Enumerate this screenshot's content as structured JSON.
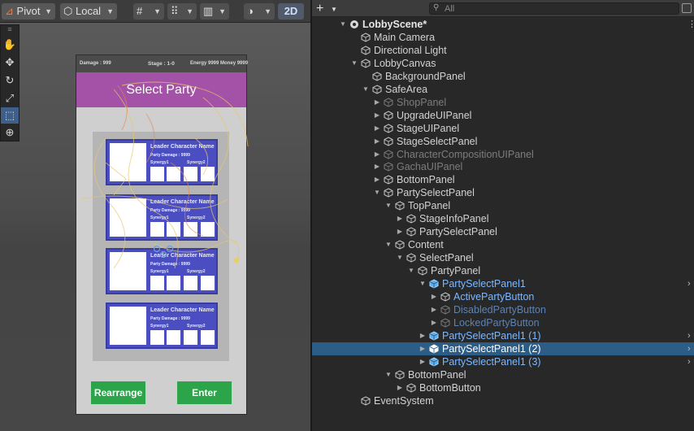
{
  "scene_toolbar": {
    "pivot_label": "Pivot",
    "local_label": "Local",
    "mode_2d_label": "2D"
  },
  "scene_tools": [
    "hand-tool",
    "move-tool",
    "rotate-tool",
    "scale-tool",
    "rect-tool",
    "transform-tool"
  ],
  "game_ui": {
    "top_info": {
      "damage": "Damage : 999",
      "stage": "Stage : 1-0",
      "energy_money": "Energy 9999 Money 9999"
    },
    "title": "Select Party",
    "parties": [
      {
        "leader": "Leader Character Name",
        "damage": "Party Damage : 9999",
        "synergy1": "Synergy1",
        "synergy2": "Synergy2"
      },
      {
        "leader": "Leader Character Name",
        "damage": "Party Damage : 9999",
        "synergy1": "Synergy1",
        "synergy2": "Synergy2"
      },
      {
        "leader": "Leader Character Name",
        "damage": "Party Damage : 9999",
        "synergy1": "Synergy1",
        "synergy2": "Synergy2"
      },
      {
        "leader": "Leader Character Name",
        "damage": "Party Damage : 9999",
        "synergy1": "Synergy1",
        "synergy2": "Synergy2"
      }
    ],
    "rearrange_label": "Rearrange",
    "enter_label": "Enter"
  },
  "hierarchy": {
    "search_placeholder": "All",
    "items": [
      {
        "label": "LobbyScene*",
        "depth": 0,
        "arrow": "expanded",
        "icon": "unity-scene-icon",
        "state": "scene"
      },
      {
        "label": "Main Camera",
        "depth": 1,
        "arrow": "none",
        "icon": "gameobject-icon",
        "state": "normal"
      },
      {
        "label": "Directional Light",
        "depth": 1,
        "arrow": "none",
        "icon": "gameobject-icon",
        "state": "normal"
      },
      {
        "label": "LobbyCanvas",
        "depth": 1,
        "arrow": "expanded",
        "icon": "gameobject-icon",
        "state": "normal"
      },
      {
        "label": "BackgroundPanel",
        "depth": 2,
        "arrow": "none",
        "icon": "gameobject-icon",
        "state": "normal"
      },
      {
        "label": "SafeArea",
        "depth": 2,
        "arrow": "expanded",
        "icon": "gameobject-icon",
        "state": "normal"
      },
      {
        "label": "ShopPanel",
        "depth": 3,
        "arrow": "collapsed",
        "icon": "gameobject-icon",
        "state": "disabled"
      },
      {
        "label": "UpgradeUIPanel",
        "depth": 3,
        "arrow": "collapsed",
        "icon": "gameobject-icon",
        "state": "normal"
      },
      {
        "label": "StageUIPanel",
        "depth": 3,
        "arrow": "collapsed",
        "icon": "gameobject-icon",
        "state": "normal"
      },
      {
        "label": "StageSelectPanel",
        "depth": 3,
        "arrow": "collapsed",
        "icon": "gameobject-icon",
        "state": "normal"
      },
      {
        "label": "CharacterCompositionUIPanel",
        "depth": 3,
        "arrow": "collapsed",
        "icon": "gameobject-icon",
        "state": "disabled"
      },
      {
        "label": "GachaUIPanel",
        "depth": 3,
        "arrow": "collapsed",
        "icon": "gameobject-icon",
        "state": "disabled"
      },
      {
        "label": "BottomPanel",
        "depth": 3,
        "arrow": "collapsed",
        "icon": "gameobject-icon",
        "state": "normal"
      },
      {
        "label": "PartySelectPanel",
        "depth": 3,
        "arrow": "expanded",
        "icon": "gameobject-icon",
        "state": "normal"
      },
      {
        "label": "TopPanel",
        "depth": 4,
        "arrow": "expanded",
        "icon": "gameobject-icon",
        "state": "normal"
      },
      {
        "label": "StageInfoPanel",
        "depth": 5,
        "arrow": "collapsed",
        "icon": "gameobject-icon",
        "state": "normal"
      },
      {
        "label": "PartySelectPanel",
        "depth": 5,
        "arrow": "collapsed",
        "icon": "gameobject-icon",
        "state": "normal"
      },
      {
        "label": "Content",
        "depth": 4,
        "arrow": "expanded",
        "icon": "gameobject-icon",
        "state": "normal"
      },
      {
        "label": "SelectPanel",
        "depth": 5,
        "arrow": "expanded",
        "icon": "gameobject-icon",
        "state": "normal"
      },
      {
        "label": "PartyPanel",
        "depth": 6,
        "arrow": "expanded",
        "icon": "gameobject-icon",
        "state": "normal"
      },
      {
        "label": "PartySelectPanel1",
        "depth": 7,
        "arrow": "expanded",
        "icon": "prefab-icon",
        "state": "prefab",
        "more": true
      },
      {
        "label": "ActivePartyButton",
        "depth": 8,
        "arrow": "collapsed",
        "icon": "gameobject-icon",
        "state": "prefab-child"
      },
      {
        "label": "DisabledPartyButton",
        "depth": 8,
        "arrow": "collapsed",
        "icon": "gameobject-icon",
        "state": "prefab-child-disabled"
      },
      {
        "label": "LockedPartyButton",
        "depth": 8,
        "arrow": "collapsed",
        "icon": "gameobject-icon",
        "state": "prefab-child-disabled"
      },
      {
        "label": "PartySelectPanel1 (1)",
        "depth": 7,
        "arrow": "collapsed",
        "icon": "prefab-icon",
        "state": "prefab",
        "more": true
      },
      {
        "label": "PartySelectPanel1 (2)",
        "depth": 7,
        "arrow": "collapsed",
        "icon": "prefab-icon",
        "state": "prefab-selected",
        "more": true
      },
      {
        "label": "PartySelectPanel1 (3)",
        "depth": 7,
        "arrow": "collapsed",
        "icon": "prefab-icon",
        "state": "prefab",
        "more": true
      },
      {
        "label": "BottomPanel",
        "depth": 4,
        "arrow": "expanded",
        "icon": "gameobject-icon",
        "state": "normal"
      },
      {
        "label": "BottomButton",
        "depth": 5,
        "arrow": "collapsed",
        "icon": "gameobject-icon",
        "state": "normal"
      },
      {
        "label": "EventSystem",
        "depth": 1,
        "arrow": "none",
        "icon": "gameobject-icon",
        "state": "normal"
      }
    ]
  },
  "colors": {
    "selection": "#2c5d87",
    "prefab_text": "#7cb8ff",
    "disabled_text": "#7d7d7d",
    "party_panel": "#4b4ec0",
    "title_bar": "#a452a8",
    "button_green": "#2ca44a"
  }
}
